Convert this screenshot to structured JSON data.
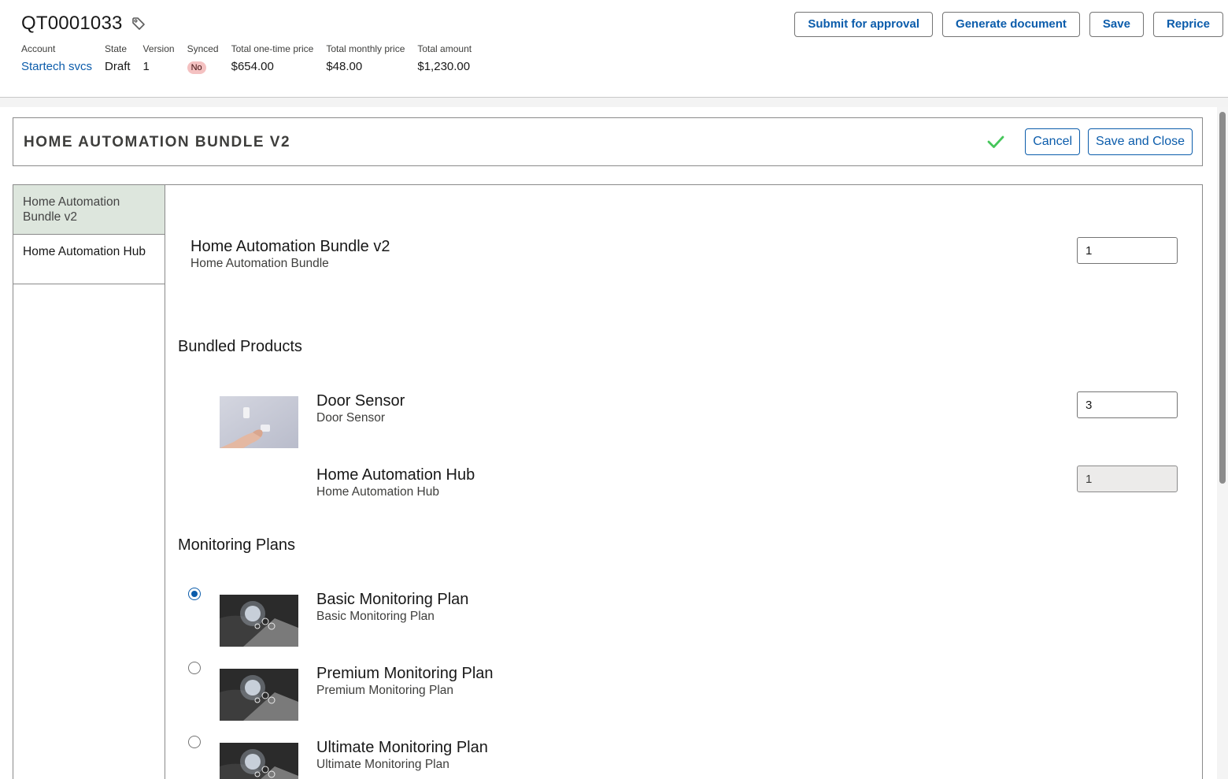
{
  "header": {
    "quote_number": "QT0001033",
    "fields": [
      {
        "label": "Account",
        "value": "Startech svcs"
      },
      {
        "label": "State",
        "value": "Draft"
      },
      {
        "label": "Version",
        "value": "1"
      },
      {
        "label": "Synced",
        "value": "No"
      },
      {
        "label": "Total one-time price",
        "value": "$654.00"
      },
      {
        "label": "Total monthly price",
        "value": "$48.00"
      },
      {
        "label": "Total amount",
        "value": "$1,230.00"
      }
    ],
    "actions": {
      "submit": "Submit for approval",
      "generate": "Generate document",
      "save": "Save",
      "reprice": "Reprice"
    }
  },
  "bundle": {
    "title": "HOME AUTOMATION BUNDLE V2",
    "cancel": "Cancel",
    "save_close": "Save and Close"
  },
  "sidebar": {
    "items": [
      {
        "label": "Home Automation Bundle v2"
      },
      {
        "label": "Home Automation Hub"
      }
    ]
  },
  "main_product": {
    "name": "Home Automation Bundle v2",
    "sub": "Home Automation Bundle",
    "qty": "1"
  },
  "bundled": {
    "title": "Bundled Products",
    "items": [
      {
        "name": "Door Sensor",
        "sub": "Door Sensor",
        "qty": "3"
      },
      {
        "name": "Home Automation Hub",
        "sub": "Home Automation Hub",
        "qty": "1"
      }
    ]
  },
  "monitoring": {
    "title": "Monitoring Plans",
    "items": [
      {
        "name": "Basic Monitoring Plan",
        "sub": "Basic Monitoring Plan",
        "selected": true
      },
      {
        "name": "Premium Monitoring Plan",
        "sub": "Premium Monitoring Plan",
        "selected": false
      },
      {
        "name": "Ultimate Monitoring Plan",
        "sub": "Ultimate Monitoring Plan",
        "selected": false
      }
    ]
  },
  "colors": {
    "brand_blue": "#0b5cab",
    "active_side": "#dde6dd",
    "success_check": "#45c65a",
    "badge_bg": "#f4c1c1"
  },
  "icons": [
    "tag-icon",
    "check-icon"
  ]
}
